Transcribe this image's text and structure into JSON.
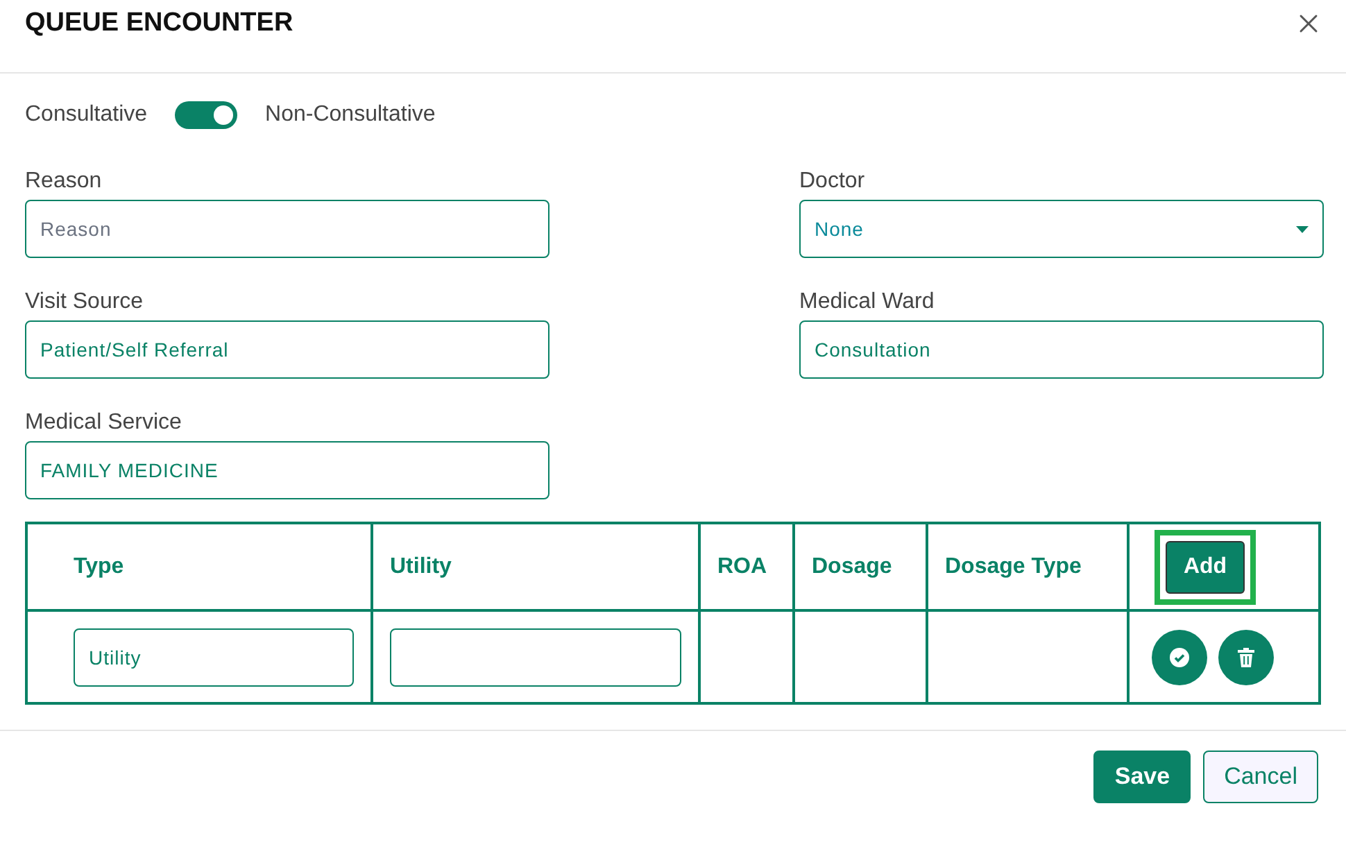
{
  "dialog": {
    "title": "QUEUE ENCOUNTER"
  },
  "toggle": {
    "left_label": "Consultative",
    "right_label": "Non-Consultative",
    "on": true
  },
  "fields": [
    {
      "label": "Reason",
      "kind": "text",
      "placeholder": "Reason"
    },
    {
      "label": "Doctor",
      "kind": "select",
      "value": "None"
    },
    {
      "label": "Visit Source",
      "kind": "text",
      "value": "Patient/Self Referral"
    },
    {
      "label": "Medical Ward",
      "kind": "text",
      "value": "Consultation"
    },
    {
      "label": "Medical Service",
      "kind": "text",
      "value": "FAMILY MEDICINE"
    }
  ],
  "table": {
    "columns": [
      "Type",
      "Utility",
      "ROA",
      "Dosage",
      "Dosage Type"
    ],
    "add_button": {
      "label": "Add",
      "focused": true
    },
    "rows": [
      {
        "type": "Utility",
        "utility": ""
      }
    ]
  },
  "buttons": [
    {
      "label": "Save",
      "kind": "primary"
    },
    {
      "label": "Cancel",
      "kind": "secondary"
    }
  ]
}
